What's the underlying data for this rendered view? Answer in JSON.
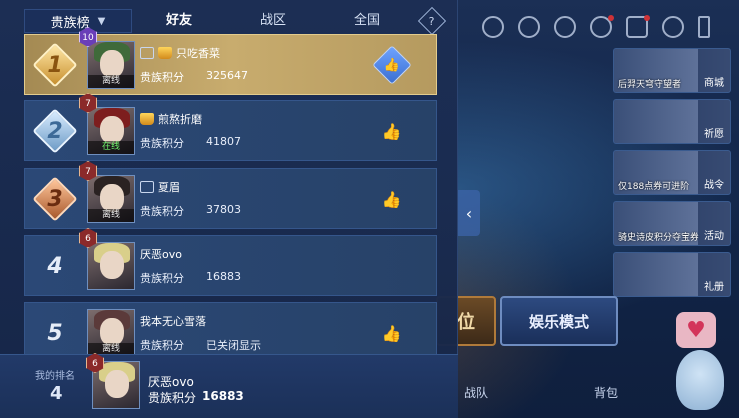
{
  "tabs": {
    "dropdown_label": "贵族榜",
    "items": [
      "好友",
      "战区",
      "全国"
    ],
    "active_index": 0,
    "help_label": "?"
  },
  "rows": [
    {
      "rank": "1",
      "name": "只吃香菜",
      "score_label": "贵族积分",
      "score": "325647",
      "level": "10",
      "status": "离线",
      "like": "👍"
    },
    {
      "rank": "2",
      "name": "煎熬折磨",
      "score_label": "贵族积分",
      "score": "41807",
      "level": "7",
      "status": "在线",
      "like": "👍"
    },
    {
      "rank": "3",
      "name": "夏眉",
      "score_label": "贵族积分",
      "score": "37803",
      "level": "7",
      "status": "离线",
      "like": "👍"
    },
    {
      "rank": "4",
      "name": "厌恶ovo",
      "score_label": "贵族积分",
      "score": "16883",
      "level": "6",
      "status": "",
      "like": ""
    },
    {
      "rank": "5",
      "name": "我本无心雪落",
      "score_label": "贵族积分",
      "score": "已关闭显示",
      "level": "",
      "status": "离线",
      "like": "👍"
    }
  ],
  "my_rank": {
    "label": "我的排名",
    "position": "4",
    "name": "厌恶ovo",
    "score_label": "贵族积分",
    "score": "16883",
    "level": "6"
  },
  "background": {
    "right_cards": [
      {
        "text": "后羿天穹守望者",
        "side": "商城"
      },
      {
        "text": "",
        "side": "祈愿"
      },
      {
        "text": "仅188点券可进阶",
        "side": "战令"
      },
      {
        "text": "骑史诗皮积分夺宝券",
        "side": "活动"
      },
      {
        "text": "",
        "side": "礼册"
      }
    ],
    "mode_button": "娱乐模式",
    "rank_button": "位",
    "bottom_items": [
      "战队",
      "背包"
    ],
    "side_arrow": "‹",
    "heart": "♥"
  },
  "colors": {
    "first_row_gold": "#c8ac6e",
    "row_blue": "#2b4876",
    "like_blue": "#3b6fd1"
  }
}
